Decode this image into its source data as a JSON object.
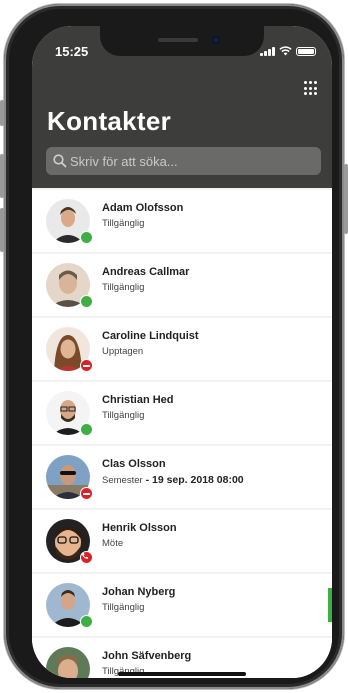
{
  "status_bar": {
    "time": "15:25"
  },
  "header": {
    "title": "Kontakter"
  },
  "search": {
    "placeholder": "Skriv för att söka..."
  },
  "contacts": [
    {
      "name": "Adam Olofsson",
      "status": "Tillgänglig",
      "presence": "available"
    },
    {
      "name": "Andreas Callmar",
      "status": "Tillgänglig",
      "presence": "available"
    },
    {
      "name": "Caroline Lindquist",
      "status": "Upptagen",
      "presence": "busy"
    },
    {
      "name": "Christian Hed",
      "status": "Tillgänglig",
      "presence": "available"
    },
    {
      "name": "Clas Olsson",
      "status": "Semester",
      "status_extra": " - 19 sep. 2018 08:00",
      "presence": "busy"
    },
    {
      "name": "Henrik Olsson",
      "status": "Möte",
      "presence": "meeting"
    },
    {
      "name": "Johan Nyberg",
      "status": "Tillgänglig",
      "presence": "available"
    },
    {
      "name": "John Säfvenberg",
      "status": "Tillgänglig",
      "presence": "available"
    }
  ],
  "colors": {
    "header": "#3d3d3c",
    "available": "#3cb043",
    "busy": "#d8232a"
  },
  "icons": [
    "search-icon",
    "dialpad-icon",
    "signal-icon",
    "wifi-icon",
    "battery-icon"
  ]
}
